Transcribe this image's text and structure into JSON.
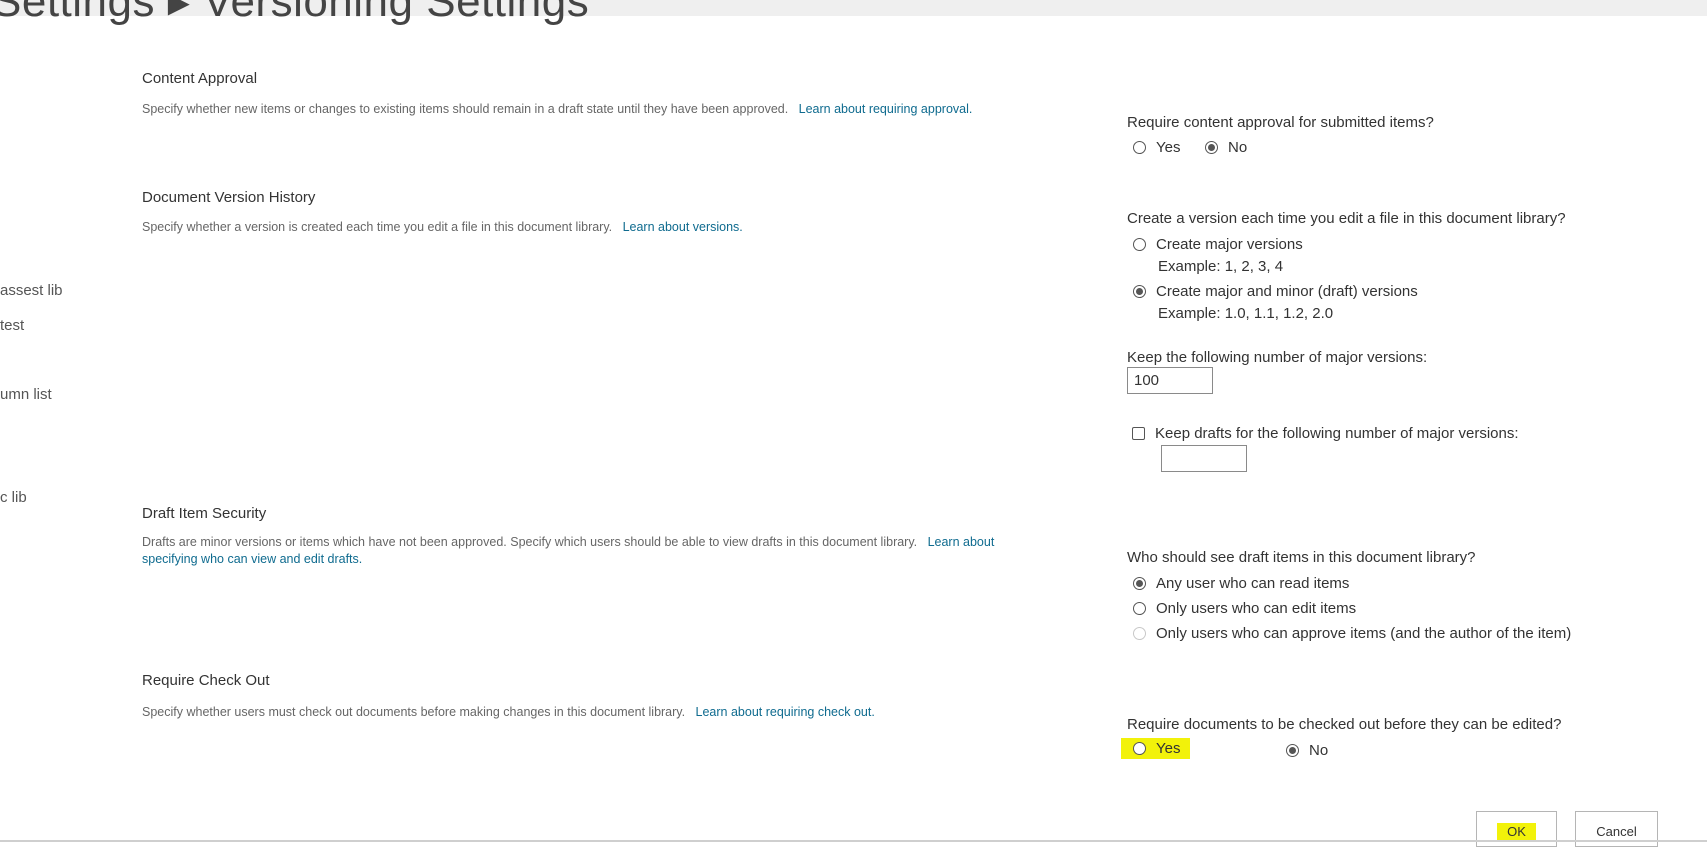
{
  "page_title": "Settings ▸ Versioning Settings",
  "nav": {
    "items": [
      "assest lib",
      "test",
      "umn list",
      "c lib"
    ]
  },
  "content_approval": {
    "title": "Content Approval",
    "description": "Specify whether new items or changes to existing items should remain in a draft state until they have been approved.",
    "link": "Learn about requiring approval.",
    "question": "Require content approval for submitted items?",
    "yes": "Yes",
    "no": "No",
    "selected": "No"
  },
  "version_history": {
    "title": "Document Version History",
    "description": "Specify whether a version is created each time you edit a file in this document library.",
    "link": "Learn about versions.",
    "question": "Create a version each time you edit a file in this document library?",
    "options": [
      {
        "label": "Create major versions",
        "example": "Example: 1, 2, 3, 4",
        "selected": false
      },
      {
        "label": "Create major and minor (draft) versions",
        "example": "Example: 1.0, 1.1, 1.2, 2.0",
        "selected": true
      }
    ],
    "major_label": "Keep the following number of major versions:",
    "major_value": "100",
    "drafts_label": "Keep drafts for the following number of major versions:",
    "drafts_value": "",
    "drafts_checked": false
  },
  "draft_security": {
    "title": "Draft Item Security",
    "description": "Drafts are minor versions or items which have not been approved. Specify which users should be able to view drafts in this document library.",
    "link": "Learn about specifying who can view and edit drafts.",
    "question": "Who should see draft items in this document library?",
    "options": [
      {
        "label": "Any user who can read items",
        "selected": true,
        "disabled": false
      },
      {
        "label": "Only users who can edit items",
        "selected": false,
        "disabled": false
      },
      {
        "label": "Only users who can approve items (and the author of the item)",
        "selected": false,
        "disabled": true
      }
    ]
  },
  "check_out": {
    "title": "Require Check Out",
    "description": "Specify whether users must check out documents before making changes in this document library.",
    "link": "Learn about requiring check out.",
    "question": "Require documents to be checked out before they can be edited?",
    "yes": "Yes",
    "no": "No",
    "selected": "No",
    "highlight_color": "#f2f20a"
  },
  "buttons": {
    "ok": "OK",
    "cancel": "Cancel"
  },
  "colors": {
    "link": "#0f6b8f",
    "highlight": "#f2f20a"
  }
}
